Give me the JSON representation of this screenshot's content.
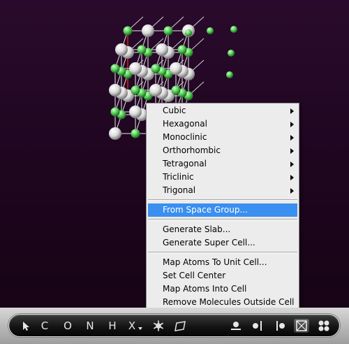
{
  "menu": {
    "groups": [
      [
        {
          "label": "Cubic",
          "submenu": true
        },
        {
          "label": "Hexagonal",
          "submenu": true
        },
        {
          "label": "Monoclinic",
          "submenu": true
        },
        {
          "label": "Orthorhombic",
          "submenu": true
        },
        {
          "label": "Tetragonal",
          "submenu": true
        },
        {
          "label": "Triclinic",
          "submenu": true
        },
        {
          "label": "Trigonal",
          "submenu": true
        }
      ],
      [
        {
          "label": "From Space Group...",
          "submenu": false,
          "selected": true
        }
      ],
      [
        {
          "label": "Generate Slab...",
          "submenu": false
        },
        {
          "label": "Generate Super Cell...",
          "submenu": false
        }
      ],
      [
        {
          "label": "Map Atoms To Unit Cell...",
          "submenu": false
        },
        {
          "label": "Set Cell Center",
          "submenu": false
        },
        {
          "label": "Map Atoms Into Cell",
          "submenu": false
        },
        {
          "label": "Remove Molecules Outside Cell",
          "submenu": false
        }
      ]
    ]
  },
  "toolbar": {
    "element_carbon": "C",
    "element_oxygen": "O",
    "element_nitrogen": "N",
    "element_hydrogen": "H",
    "element_other": "X",
    "icons": [
      "select-arrow-icon",
      "element-x-dropdown-icon",
      "snowflake-icon",
      "parallelogram-icon",
      "bond-tool-icon",
      "atom-translate-icon",
      "axis-tool-icon",
      "unit-cell-icon",
      "view-grid-icon"
    ]
  },
  "colors": {
    "background_top": "#2a0a2c",
    "background_bottom": "#150313",
    "sodium_atom": "#f2f2f2",
    "chlorine_atom": "#5bd35b",
    "cell_edge": "#cc2222",
    "menu_selected": "#3a8ff0"
  }
}
